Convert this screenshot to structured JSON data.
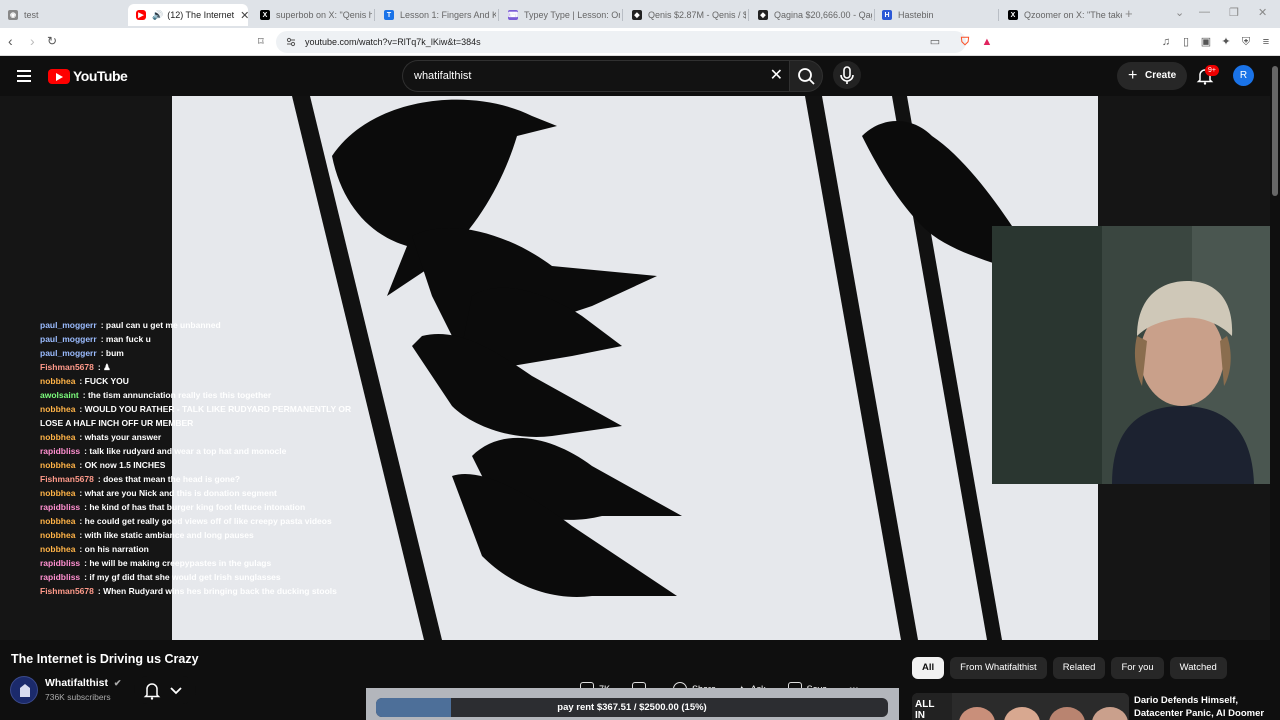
{
  "browser": {
    "tabs": [
      {
        "title": "test",
        "icon": "globe-icon",
        "color": "#888888"
      },
      {
        "title": "(12) The Internet",
        "icon": "youtube-icon",
        "color": "#ff0000",
        "active": true
      },
      {
        "title": "superbob on X: \"Qenis ha",
        "icon": "x-icon",
        "color": "#000000"
      },
      {
        "title": "Lesson 1: Fingers And Ke",
        "icon": "typing-icon",
        "color": "#1a73e8"
      },
      {
        "title": "Typey Type | Lesson: One",
        "icon": "typey-icon",
        "color": "#7b5cd6"
      },
      {
        "title": "Qenis $2.87M - Qenis / $",
        "icon": "dex-icon",
        "color": "#222222"
      },
      {
        "title": "Qagina $20,666.00 - Qag",
        "icon": "dex-icon",
        "color": "#222222"
      },
      {
        "title": "Hastebin",
        "icon": "hastebin-icon",
        "color": "#2b58d6"
      },
      {
        "title": "Qzoomer on X: \"The take",
        "icon": "x-icon",
        "color": "#000000"
      }
    ],
    "url": "youtube.com/watch?v=RlTq7k_lKiw&t=384s"
  },
  "youtube": {
    "logo_text": "YouTube",
    "search_value": "whatifalthist",
    "create_label": "Create",
    "notif_badge": "9+",
    "avatar_letter": "R"
  },
  "chat": [
    {
      "user": "paul_moggerr",
      "color": "#9bbcff",
      "msg": "paul can u get me unbanned"
    },
    {
      "user": "paul_moggerr",
      "color": "#9bbcff",
      "msg": "man fuck u"
    },
    {
      "user": "paul_moggerr",
      "color": "#9bbcff",
      "msg": "bum"
    },
    {
      "user": "Fishman5678",
      "color": "#ff9a8a",
      "msg": "♟"
    },
    {
      "user": "nobbhea",
      "color": "#ffb347",
      "msg": "FUCK YOU"
    },
    {
      "user": "awolsaint",
      "color": "#7cfc7c",
      "msg": "the tism annunciation really ties this together"
    },
    {
      "user": "nobbhea",
      "color": "#ffb347",
      "msg": "WOULD YOU RATHER - TALK LIKE RUDYARD PERMANENTLY OR"
    },
    {
      "user": "",
      "color": "#ffffff",
      "msg": "LOSE A HALF INCH OFF UR MEMBER"
    },
    {
      "user": "nobbhea",
      "color": "#ffb347",
      "msg": "whats your answer"
    },
    {
      "user": "rapidbliss",
      "color": "#ff8fd0",
      "msg": "talk like rudyard and wear a top hat and monocle"
    },
    {
      "user": "nobbhea",
      "color": "#ffb347",
      "msg": "OK now 1.5 INCHES"
    },
    {
      "user": "Fishman5678",
      "color": "#ff9a8a",
      "msg": "does that mean the head is gone?"
    },
    {
      "user": "nobbhea",
      "color": "#ffb347",
      "msg": "what are you Nick and this is donation segment"
    },
    {
      "user": "rapidbliss",
      "color": "#ff8fd0",
      "msg": "he kind of has that burger king foot lettuce intonation"
    },
    {
      "user": "nobbhea",
      "color": "#ffb347",
      "msg": "he could get really good views off of like creepy pasta videos"
    },
    {
      "user": "nobbhea",
      "color": "#ffb347",
      "msg": "with like static ambiance and long pauses"
    },
    {
      "user": "nobbhea",
      "color": "#ffb347",
      "msg": "on his narration"
    },
    {
      "user": "rapidbliss",
      "color": "#ff8fd0",
      "msg": "he will be making creepypastes in the gulags"
    },
    {
      "user": "rapidbliss",
      "color": "#ff8fd0",
      "msg": "if my gf did that she would get Irish sunglasses"
    },
    {
      "user": "Fishman5678",
      "color": "#ff9a8a",
      "msg": "When Rudyard wins hes bringing back the ducking stools"
    }
  ],
  "video": {
    "title": "The Internet is Driving us Crazy",
    "channel": "Whatifalthist",
    "subscribers": "736K subscribers"
  },
  "actions": {
    "likes": "7K",
    "share": "Share",
    "ask": "Ask",
    "save": "Save"
  },
  "overlay": {
    "rent_text": "pay rent $367.51 / $2500.00 (15%)",
    "rent_fraction": 0.147
  },
  "sidebar": {
    "chips": [
      "All",
      "From Whatifalthist",
      "Related",
      "For you",
      "Watched"
    ],
    "rec_title": "Dario Defends Himself, Datacenter Panic, AI Doomer"
  }
}
